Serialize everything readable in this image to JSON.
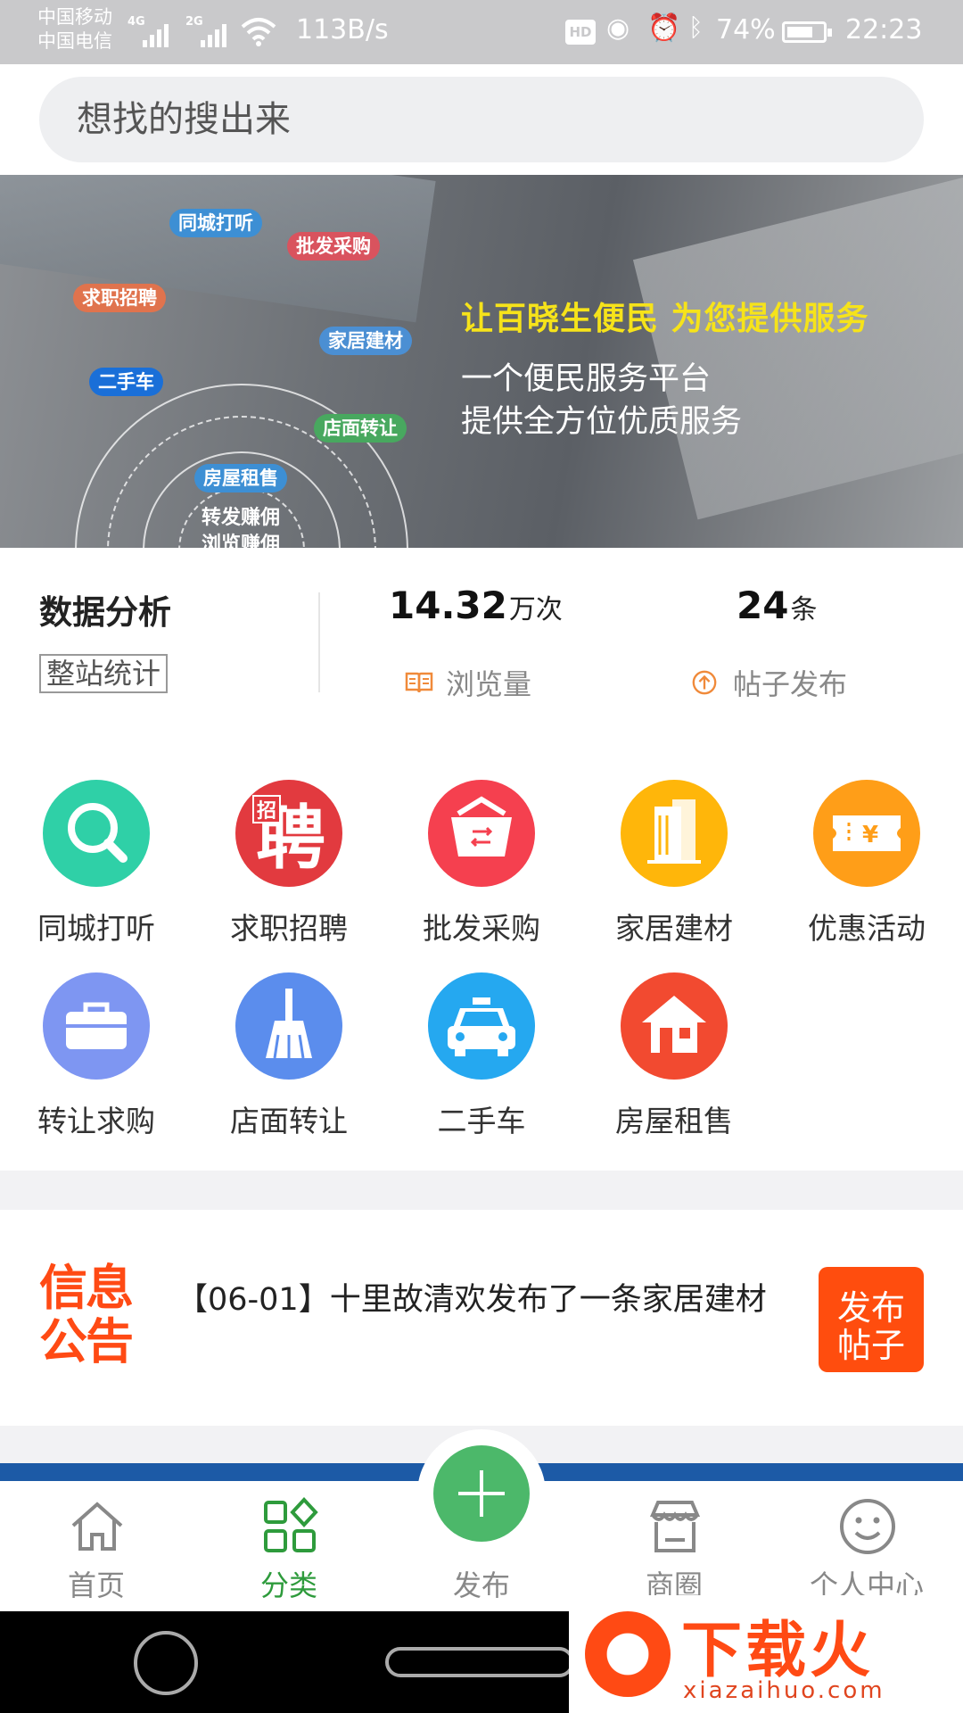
{
  "status_bar": {
    "carrier_1": "中国移动",
    "carrier_2": "中国电信",
    "net_1": "4G",
    "net_2": "2G",
    "speed": "113B/s",
    "hd": "HD",
    "battery": "74%",
    "battery_level": 0.74,
    "time": "22:23"
  },
  "search": {
    "placeholder": "想找的搜出来"
  },
  "banner": {
    "center_line_1": "转发赚佣",
    "center_line_2": "浏览赚佣",
    "tags": [
      "同城打听",
      "批发采购",
      "求职招聘",
      "家居建材",
      "二手车",
      "店面转让",
      "房屋租售"
    ],
    "headline": "让百晓生便民   为您提供服务",
    "subline_1": "一个便民服务平台",
    "subline_2": "提供全方位优质服务"
  },
  "stats": {
    "title": "数据分析",
    "badge": "整站统计",
    "views_value": "14.32",
    "views_unit": "万次",
    "views_label": "浏览量",
    "posts_value": "24",
    "posts_unit": "条",
    "posts_label": "帖子发布"
  },
  "categories": [
    {
      "label": "同城打听",
      "icon": "magnifier-icon",
      "color": "#2fd0a7"
    },
    {
      "label": "求职招聘",
      "icon": "recruit-icon",
      "color": "#e23a3f"
    },
    {
      "label": "批发采购",
      "icon": "basket-icon",
      "color": "#f5404f"
    },
    {
      "label": "家居建材",
      "icon": "building-icon",
      "color": "#ffb60a"
    },
    {
      "label": "优惠活动",
      "icon": "coupon-icon",
      "color": "#ff9e18"
    },
    {
      "label": "转让求购",
      "icon": "toolbox-icon",
      "color": "#7e96f2"
    },
    {
      "label": "店面转让",
      "icon": "broom-icon",
      "color": "#5b8ded"
    },
    {
      "label": "二手车",
      "icon": "car-icon",
      "color": "#25a8f0"
    },
    {
      "label": "房屋租售",
      "icon": "house-icon",
      "color": "#f24a30"
    }
  ],
  "recruit_glyph_big": "聘",
  "recruit_glyph_small": "招",
  "notice": {
    "logo_line_1": "信息",
    "logo_line_2": "公告",
    "text": "【06-01】十里故清欢发布了一条家居建材",
    "publish_line_1": "发布",
    "publish_line_2": "帖子"
  },
  "bottom_nav": {
    "home": "首页",
    "category": "分类",
    "publish": "发布",
    "shops": "商圈",
    "profile": "个人中心"
  },
  "watermark": {
    "big": "下载火",
    "small": "xiazaihuo.com"
  },
  "colors": {
    "accent_green": "#2e9b3c",
    "fab_green": "#4cb86a",
    "notice_orange": "#ff4d0e",
    "banner_yellow": "#f6e31a",
    "strip_blue": "#1c5aa6"
  }
}
